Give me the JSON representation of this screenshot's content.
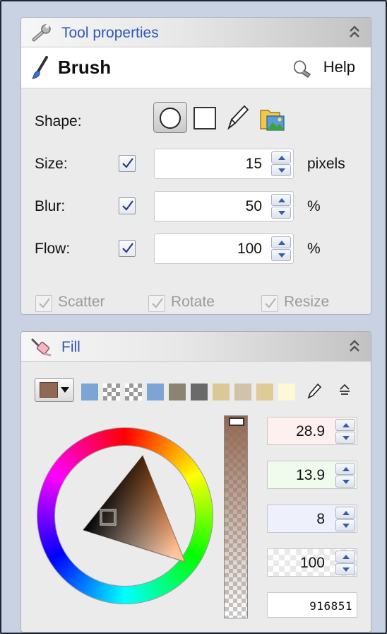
{
  "tool_panel": {
    "title": "Tool properties",
    "tool_name": "Brush",
    "help_label": "Help",
    "shape_label": "Shape:",
    "shapes": [
      "circle",
      "square",
      "pencil",
      "folder-image"
    ],
    "size": {
      "label": "Size:",
      "checked": true,
      "value": "15",
      "unit": "pixels"
    },
    "blur": {
      "label": "Blur:",
      "checked": true,
      "value": "50",
      "unit": "%"
    },
    "flow": {
      "label": "Flow:",
      "checked": true,
      "value": "100",
      "unit": "%"
    },
    "options": [
      {
        "label": "Scatter",
        "checked": true,
        "enabled": false
      },
      {
        "label": "Rotate",
        "checked": true,
        "enabled": false
      },
      {
        "label": "Resize",
        "checked": true,
        "enabled": false
      }
    ]
  },
  "fill_panel": {
    "title": "Fill",
    "current_color": "#916851",
    "swatches": [
      "#7ea4d6",
      "checker",
      "checker",
      "#7ea4d6",
      "#8a8472",
      "#6a6a6a",
      "#dcc797",
      "#cfc3a8",
      "#e0cb98",
      "#fdf8d7"
    ],
    "fields": [
      {
        "name": "hue",
        "value": "28.9",
        "tint": "#fdf0ee"
      },
      {
        "name": "saturation",
        "value": "13.9",
        "tint": "#f0fbee"
      },
      {
        "name": "value",
        "value": "8",
        "tint": "#eef0fb"
      },
      {
        "name": "alpha",
        "value": "100",
        "tint": "checker"
      }
    ],
    "hex": "916851"
  }
}
